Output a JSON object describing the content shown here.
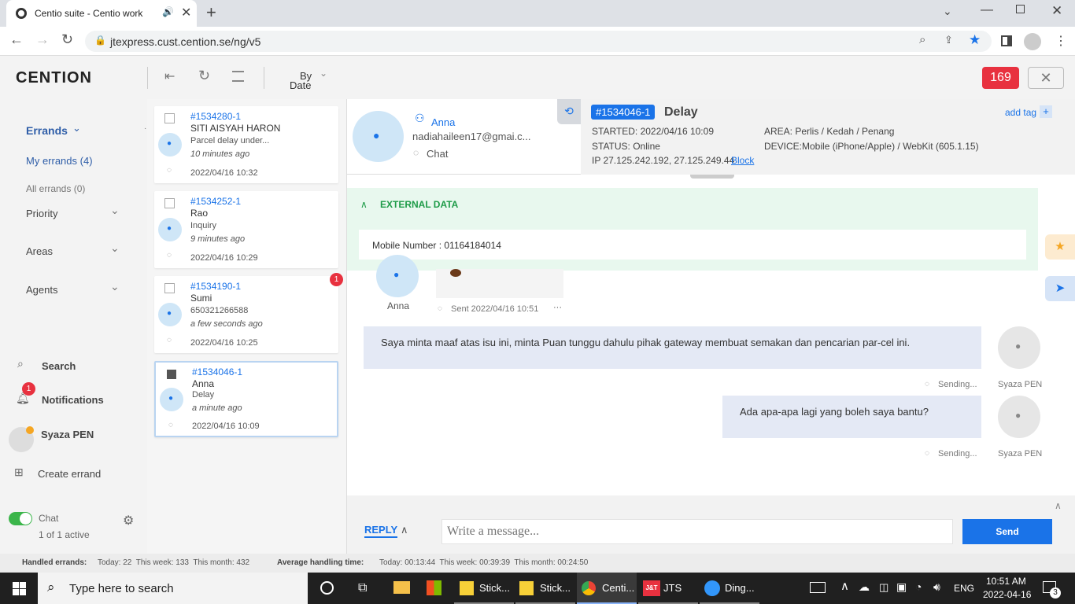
{
  "browser": {
    "tab_title": "Centio suite - Centio work",
    "url": "jtexpress.cust.cention.se/ng/v5"
  },
  "app": {
    "logo": "CENTION",
    "sort_label_1": "By",
    "sort_label_2": "Date",
    "counter": "169"
  },
  "sidebar": {
    "errands": "Errands",
    "my_errands": "My errands (4)",
    "all_errands": "All errands (0)",
    "priority": "Priority",
    "areas": "Areas",
    "agents": "Agents",
    "search": "Search",
    "notifications": "Notifications",
    "notifications_badge": "1",
    "user": "Syaza PEN",
    "create": "Create errand",
    "chat": "Chat",
    "chat_active": "1 of 1 active"
  },
  "errands": [
    {
      "id": "#1534280-1",
      "name": "SITI AISYAH HARON",
      "subject": "Parcel delay under...",
      "ago": "10 minutes ago",
      "date": "2022/04/16 10:32"
    },
    {
      "id": "#1534252-1",
      "name": "Rao",
      "subject": "Inquiry",
      "ago": "9 minutes ago",
      "date": "2022/04/16 10:29"
    },
    {
      "id": "#1534190-1",
      "name": "Sumi",
      "subject": "650321266588",
      "ago": "a few seconds ago",
      "date": "2022/04/16 10:25",
      "badge": "1"
    },
    {
      "id": "#1534046-1",
      "name": "Anna",
      "subject": "Delay",
      "ago": "a minute ago",
      "date": "2022/04/16 10:09"
    }
  ],
  "detail": {
    "contact_name": "Anna",
    "email": "nadiahaileen17@gmai.c...",
    "channel": "Chat",
    "errand_id": "#1534046-1",
    "subject": "Delay",
    "started": "STARTED: 2022/04/16 10:09",
    "status": "STATUS: Online",
    "ip": "IP 27.125.242.192, 27.125.249.44",
    "block": "Block",
    "area": "AREA: Perlis / Kedah / Penang",
    "device": "DEVICE:Mobile (iPhone/Apple) / WebKit (605.1.15)",
    "add_tag": "add tag"
  },
  "external": {
    "title": "EXTERNAL DATA",
    "mobile": "Mobile Number : 01164184014"
  },
  "messages": {
    "customer_name": "Anna",
    "customer_sent": "Sent 2022/04/16 10:51",
    "more": "···",
    "agent_msg_1": "Saya minta maaf atas isu ini, minta Puan tunggu dahulu pihak gateway membuat semakan dan pencarian par-cel ini.",
    "agent_msg_2": "Ada apa-apa lagi yang boleh saya bantu?",
    "sending": "Sending...",
    "agent_name": "Syaza PEN"
  },
  "reply": {
    "label": "REPLY",
    "placeholder": "Write a message...",
    "send": "Send"
  },
  "footer": {
    "handled_label": "Handled errands:",
    "handled": "Today: 22  This week: 133  This month: 432",
    "aht_label": "Average handling time:",
    "aht": "Today: 00:13:44  This week: 00:39:39  This month: 00:24:50"
  },
  "taskbar": {
    "search": "Type here to search",
    "apps": [
      "Stick...",
      "Stick...",
      "Centi...",
      "JTS",
      "Ding..."
    ],
    "lang": "ENG",
    "time": "10:51 AM",
    "date": "2022-04-16",
    "notif_count": "3"
  },
  "colors": {
    "accent": "#1a73e8",
    "brand_blue": "#2f5ea8",
    "counter_red": "#e8313f",
    "external_bg": "#e8f8ee"
  }
}
